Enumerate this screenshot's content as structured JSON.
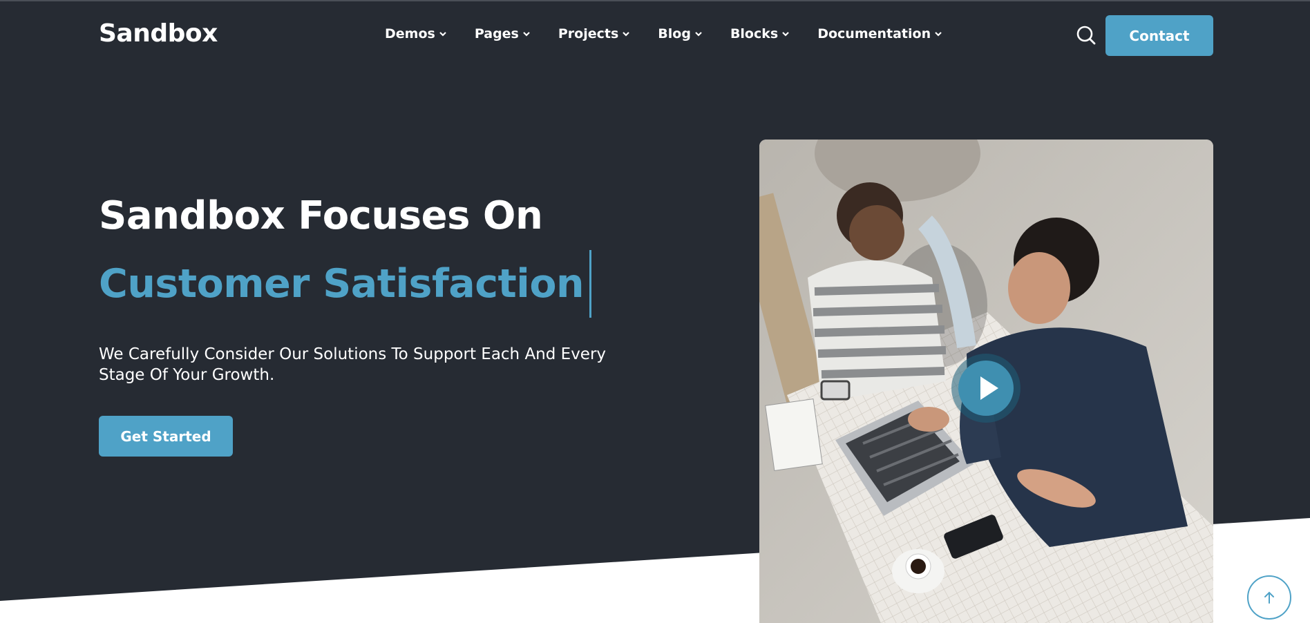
{
  "header": {
    "logo": "Sandbox",
    "nav": [
      {
        "label": "Demos"
      },
      {
        "label": "Pages"
      },
      {
        "label": "Projects"
      },
      {
        "label": "Blog"
      },
      {
        "label": "Blocks"
      },
      {
        "label": "Documentation"
      }
    ],
    "search_icon": "search-icon",
    "contact_label": "Contact"
  },
  "hero": {
    "title_line1": "Sandbox Focuses On",
    "title_line2": "Customer Satisfaction",
    "description": "We Carefully Consider Our Solutions To Support Each And Every Stage Of Your Growth.",
    "cta_label": "Get Started",
    "play_icon": "play-icon",
    "scroll_top_icon": "arrow-up-icon"
  },
  "colors": {
    "background": "#262b33",
    "accent": "#4fa2c7",
    "text": "#ffffff"
  }
}
